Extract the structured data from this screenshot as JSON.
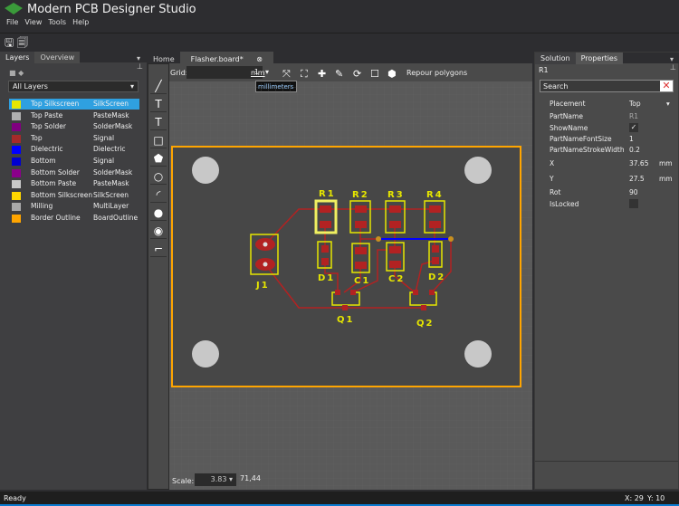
{
  "app": {
    "title": "Modern PCB Designer Studio"
  },
  "menu": [
    "File",
    "View",
    "Tools",
    "Help"
  ],
  "left_panel": {
    "tabs": [
      "Layers",
      "Overview"
    ],
    "filter": "All Layers",
    "layers": [
      {
        "name": "Top Silkscreen",
        "type": "SilkScreen",
        "color": "#e6e600"
      },
      {
        "name": "Top Paste",
        "type": "PasteMask",
        "color": "#b0b0b0"
      },
      {
        "name": "Top Solder",
        "type": "SolderMask",
        "color": "#800080"
      },
      {
        "name": "Top",
        "type": "Signal",
        "color": "#a52a2a"
      },
      {
        "name": "Dielectric",
        "type": "Dielectric",
        "color": "#0000ff"
      },
      {
        "name": "Bottom",
        "type": "Signal",
        "color": "#0000d0"
      },
      {
        "name": "Bottom Solder",
        "type": "SolderMask",
        "color": "#8b008b"
      },
      {
        "name": "Bottom Paste",
        "type": "PasteMask",
        "color": "#c8c8c8"
      },
      {
        "name": "Bottom Silkscreen",
        "type": "SilkScreen",
        "color": "#ffd700"
      },
      {
        "name": "Milling",
        "type": "MultiLayer",
        "color": "#a9a9a9"
      },
      {
        "name": "Border Outline",
        "type": "BoardOutline",
        "color": "#ffa500"
      }
    ]
  },
  "doc_tabs": [
    "Home",
    "Flasher.board*"
  ],
  "canvas_toolbar": {
    "grid_label": "Grid:",
    "grid_value": "1",
    "unit": "mm",
    "unit_tooltip": "millimeters",
    "repour": "Repour polygons"
  },
  "scale": {
    "label": "Scale:",
    "value": "3.83",
    "extra": "71,44"
  },
  "board": {
    "labels": [
      "R1",
      "R2",
      "R3",
      "R4",
      "D1",
      "C1",
      "C2",
      "D2",
      "J1",
      "Q1",
      "Q2"
    ]
  },
  "right_panel": {
    "tabs": [
      "Solution",
      "Properties"
    ],
    "selected": "R1",
    "search_placeholder": "Search",
    "props": [
      {
        "name": "Placement",
        "value": "Top"
      },
      {
        "name": "PartName",
        "value": "R1"
      },
      {
        "name": "ShowName",
        "value": "✓"
      },
      {
        "name": "PartNameFontSize",
        "value": "1"
      },
      {
        "name": "PartNameStrokeWidth",
        "value": "0.2"
      },
      {
        "name": "X",
        "value": "37.65",
        "unit": "mm"
      },
      {
        "name": "Y",
        "value": "27.5",
        "unit": "mm"
      },
      {
        "name": "Rot",
        "value": "90"
      },
      {
        "name": "IsLocked",
        "value": ""
      }
    ]
  },
  "status": {
    "text": "Ready",
    "x": "X: 29",
    "y": "Y: 10"
  }
}
